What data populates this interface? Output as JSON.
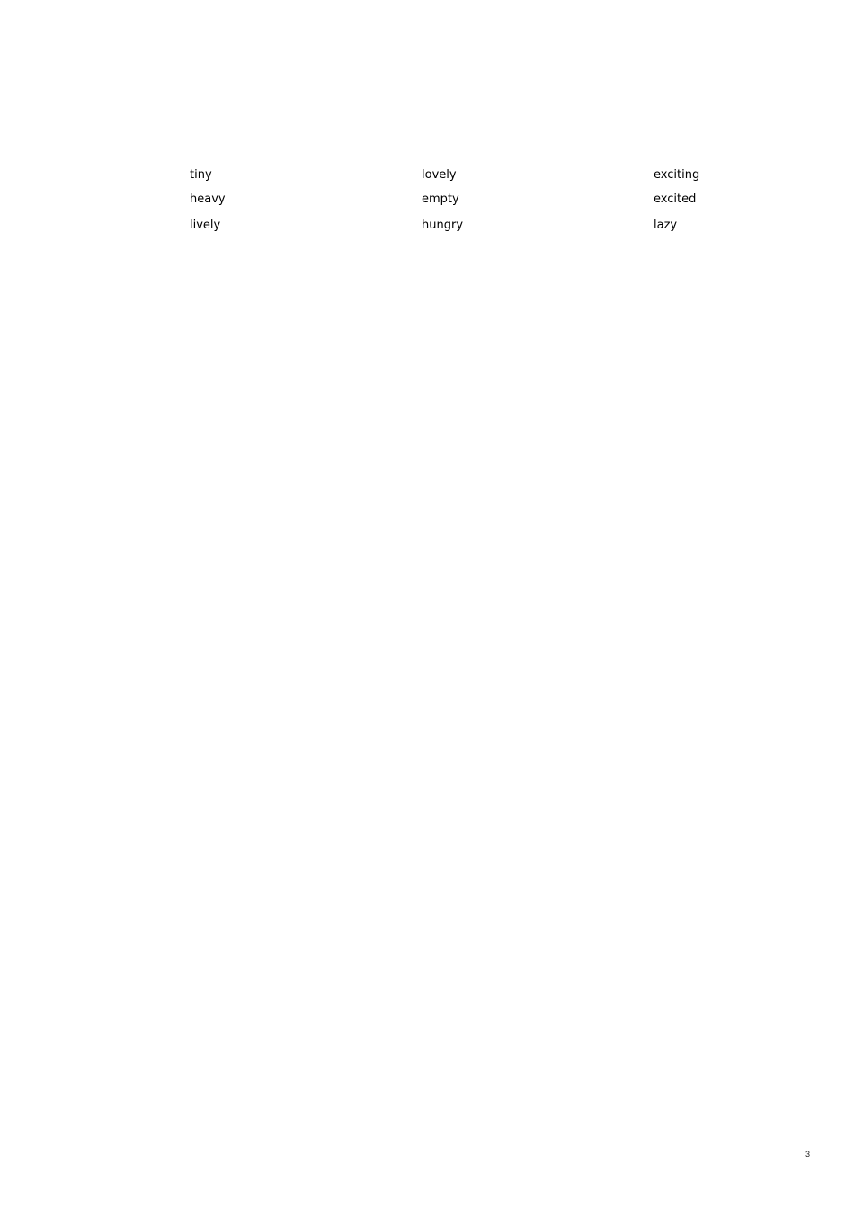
{
  "words": {
    "columns": [
      [
        "tiny",
        "heavy",
        "lively"
      ],
      [
        "lovely",
        "empty",
        "hungry"
      ],
      [
        "exciting",
        "excited",
        "lazy"
      ]
    ]
  },
  "page_number": "3"
}
